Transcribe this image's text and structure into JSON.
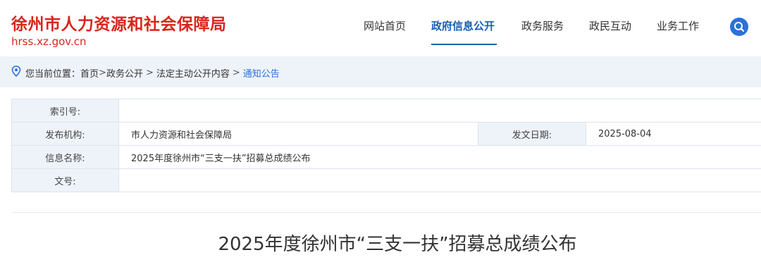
{
  "header": {
    "site_title": "徐州市人力资源和社会保障局",
    "site_domain": "hrss.xz.gov.cn",
    "brand_color": "#d9251d",
    "accent_color": "#1a5fb4"
  },
  "nav": {
    "items": [
      {
        "label": "网站首页",
        "active": false
      },
      {
        "label": "政府信息公开",
        "active": true
      },
      {
        "label": "政务服务",
        "active": false
      },
      {
        "label": "政民互动",
        "active": false
      },
      {
        "label": "业务工作",
        "active": false
      }
    ],
    "search_icon": "search-icon"
  },
  "breadcrumb": {
    "icon": "location-pin-icon",
    "prefix": "您当前位置：",
    "items": [
      "首页",
      "政务公开",
      "法定主动公开内容",
      "通知公告"
    ],
    "separators": [
      ">",
      " > ",
      " > "
    ]
  },
  "meta": {
    "index_no_label": "索引号:",
    "index_no_value": "",
    "publisher_label": "发布机构:",
    "publisher_value": "市人力资源和社会保障局",
    "date_label": "发文日期:",
    "date_value": "2025-08-04",
    "info_name_label": "信息名称:",
    "info_name_value": "2025年度徐州市“三支一扶”招募总成绩公布",
    "doc_no_label": "文号:",
    "doc_no_value": ""
  },
  "article": {
    "title": "2025年度徐州市“三支一扶”招募总成绩公布"
  }
}
